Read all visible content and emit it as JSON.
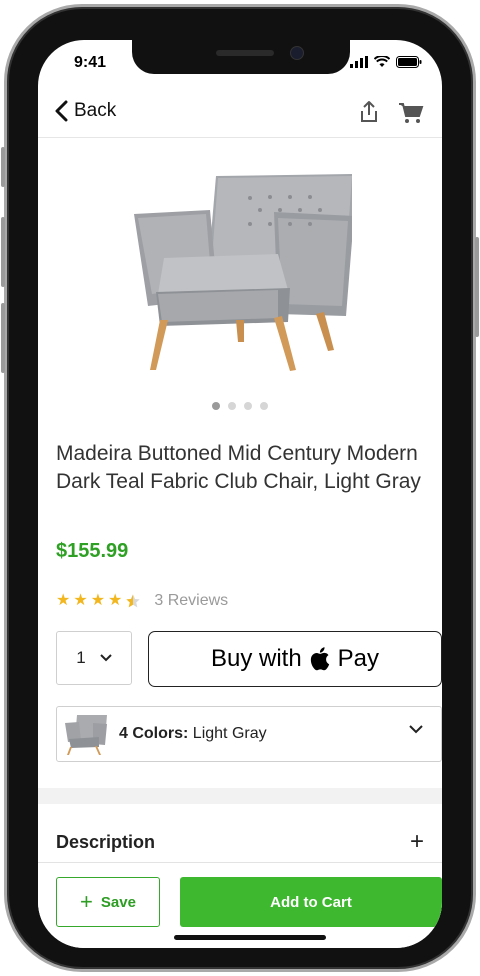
{
  "status_bar": {
    "time": "9:41"
  },
  "nav": {
    "back_label": "Back",
    "icons": [
      "chevron-left-icon",
      "share-icon",
      "cart-icon"
    ]
  },
  "product": {
    "image_icon": "armchair-image",
    "gallery": {
      "count": 4,
      "active_index": 0
    },
    "title": "Madeira Buttoned Mid Century Modern Dark Teal Fabric Club Chair, Light Gray",
    "price": "$155.99",
    "rating": {
      "value": 4.5,
      "max": 5,
      "reviews_label": "3 Reviews"
    },
    "quantity": "1",
    "apple_pay": {
      "prefix": "Buy with",
      "suffix": "Pay"
    },
    "colors": {
      "label": "4 Colors:",
      "selected": "Light Gray"
    }
  },
  "description": {
    "label": "Description",
    "expand_symbol": "+"
  },
  "actions": {
    "save_label": "Save",
    "add_to_cart_label": "Add to Cart"
  },
  "colors": {
    "accent_green": "#3db82f",
    "price_green": "#2ea024",
    "star": "#f2b61f"
  }
}
